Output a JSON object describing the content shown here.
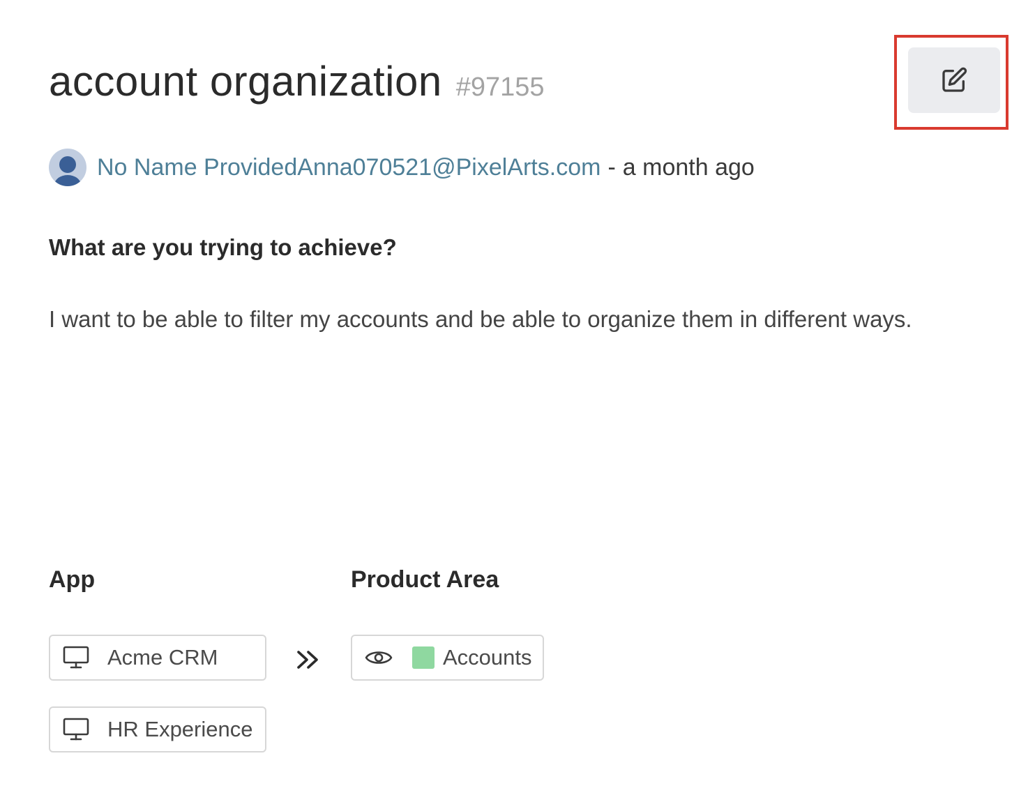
{
  "idea": {
    "title": "account organization",
    "id_label": "#97155"
  },
  "edit_button": {
    "icon": "edit-icon",
    "highlight_color": "#d93a2f"
  },
  "author": {
    "name_email": "No Name ProvidedAnna070521@PixelArts.com",
    "separator": "-",
    "time": "a month ago",
    "link_color": "#4e7f97"
  },
  "question": "What are you trying to achieve?",
  "answer": "I want to be able to filter my accounts and be able to organize them in different ways.",
  "app_section": {
    "label": "App",
    "items": [
      {
        "label": "Acme CRM",
        "icon": "monitor-icon"
      },
      {
        "label": "HR Experience",
        "icon": "monitor-icon"
      }
    ]
  },
  "relation_icon": "double-chevron-right-icon",
  "product_area_section": {
    "label": "Product Area",
    "items": [
      {
        "label": "Accounts",
        "icon": "eye-icon",
        "swatch_color": "#8fd8a0"
      }
    ]
  }
}
